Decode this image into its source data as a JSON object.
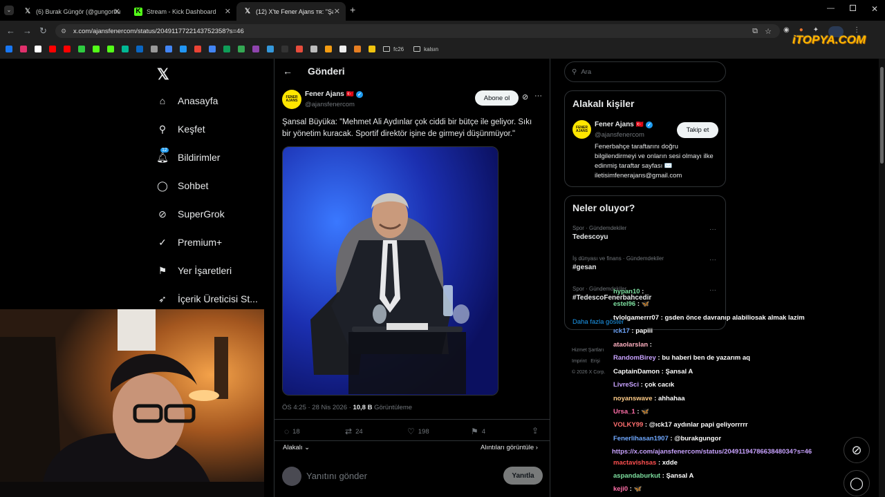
{
  "browser": {
    "tabs": [
      {
        "title": "(6) Burak Güngör (@gungorbu",
        "icon": "x-logo"
      },
      {
        "title": "Stream - Kick Dashboard",
        "icon": "kick-logo"
      },
      {
        "title": "(12) X'te Fener Ajans ᴛʀ: \"Şansa",
        "icon": "x-logo"
      }
    ],
    "url": "x.com/ajansfenercom/status/2049117722143752358?s=46",
    "bookmarks": [
      "fc26",
      "kalsın"
    ],
    "watermark": "iTOPYA.COM"
  },
  "x_nav": {
    "items": [
      "Anasayfa",
      "Keşfet",
      "Bildirimler",
      "Sohbet",
      "SuperGrok",
      "Premium+",
      "Yer İşaretleri",
      "İçerik Üreticisi St..."
    ],
    "notification_badge": "12"
  },
  "post_header": {
    "title": "Gönderi"
  },
  "post": {
    "author_name": "Fener Ajans",
    "author_flag": "🇹🇷",
    "author_handle": "@ajansfenercom",
    "avatar_text": "FENER AJANS",
    "subscribe_label": "Abone ol",
    "text": "Şansal Büyüka: \"Mehmet Ali Aydınlar çok ciddi bir bütçe ile geliyor. Sıkı bir yönetim kuracak. Sportif direktör işine de girmeyi düşünmüyor.\"",
    "time": "ÖS 4:25 · 28 Nis 2026 · ",
    "views_value": "10,8 B",
    "views_label": " Görüntüleme",
    "replies": "18",
    "reposts": "24",
    "likes": "198",
    "bookmarks": "4",
    "sort_label": "Alakalı",
    "quotes_label": "Alıntıları görüntüle",
    "reply_placeholder": "Yanıtını gönder",
    "reply_button": "Yanıtla"
  },
  "search": {
    "placeholder": "Ara"
  },
  "related": {
    "title": "Alakalı kişiler",
    "name": "Fener Ajans",
    "handle": "@ajansfenercom",
    "follow": "Takip et",
    "bio": "Fenerbahçe taraftarını doğru bilgilendirmeyi ve onların sesi olmayı ilke edinmiş taraftar sayfası ✉️ iletisimfenerajans@gmail.com"
  },
  "trends": {
    "title": "Neler oluyor?",
    "items": [
      {
        "category": "Spor · Gündemdekiler",
        "name": "Tedescoyu"
      },
      {
        "category": "İş dünyası ve finans · Gündemdekiler",
        "name": "#gesan"
      },
      {
        "category": "Spor · Gündemdekiler",
        "name": "#TedescoFenerbahcedir"
      }
    ],
    "more": "Daha fazla göster"
  },
  "footer": {
    "lines": [
      "Hizmet Şartları",
      "Imprint",
      "Erişi",
      "© 2026 X Corp."
    ]
  },
  "chat": [
    {
      "user": "hypan10",
      "color": "#7ee0a0",
      "msg": " : "
    },
    {
      "user": "estel96",
      "color": "#7ee0a0",
      "msg": " : 🦋"
    },
    {
      "user": "tvlolgamerrr07",
      "color": "#ffffff",
      "msg": " : gsden önce davranıp alabiliosak almak lazim"
    },
    {
      "user": "ıck17",
      "color": "#6fa8ff",
      "msg": " : papiii"
    },
    {
      "user": "ataolarslan",
      "color": "#ffb0c0",
      "msg": " : "
    },
    {
      "user": "RandomBirey",
      "color": "#c8a2ff",
      "msg": " : bu haberi ben de yazarım aq"
    },
    {
      "user": "CaptainDamon",
      "color": "#ffffff",
      "msg": " : Şansal A"
    },
    {
      "user": "LivreSci",
      "color": "#c8a2ff",
      "msg": " : çok cacık"
    },
    {
      "user": "noyanswave",
      "color": "#ffcc88",
      "msg": " : ahhahaa"
    },
    {
      "user": "Ursa_1",
      "color": "#ff6fa8",
      "msg": " : 🦋"
    },
    {
      "user": "VOLKY99",
      "color": "#ff6f6f",
      "msg": " : @ıck17 aydınlar papi geliyorrrrr"
    },
    {
      "user": "Fenerlihasan1907",
      "color": "#6fa8ff",
      "msg": " : @burakgungor"
    },
    {
      "user": "",
      "color": "#c8a2ff",
      "msg": "https://x.com/ajansfenercom/status/2049119478663848034?s=46"
    },
    {
      "user": "mactavishsas",
      "color": "#ff5050",
      "msg": " : xdde"
    },
    {
      "user": "aspandaburkut",
      "color": "#7ee0a0",
      "msg": " : Şansal A"
    },
    {
      "user": "keji0",
      "color": "#ff6fa8",
      "msg": " : 🦋"
    }
  ]
}
